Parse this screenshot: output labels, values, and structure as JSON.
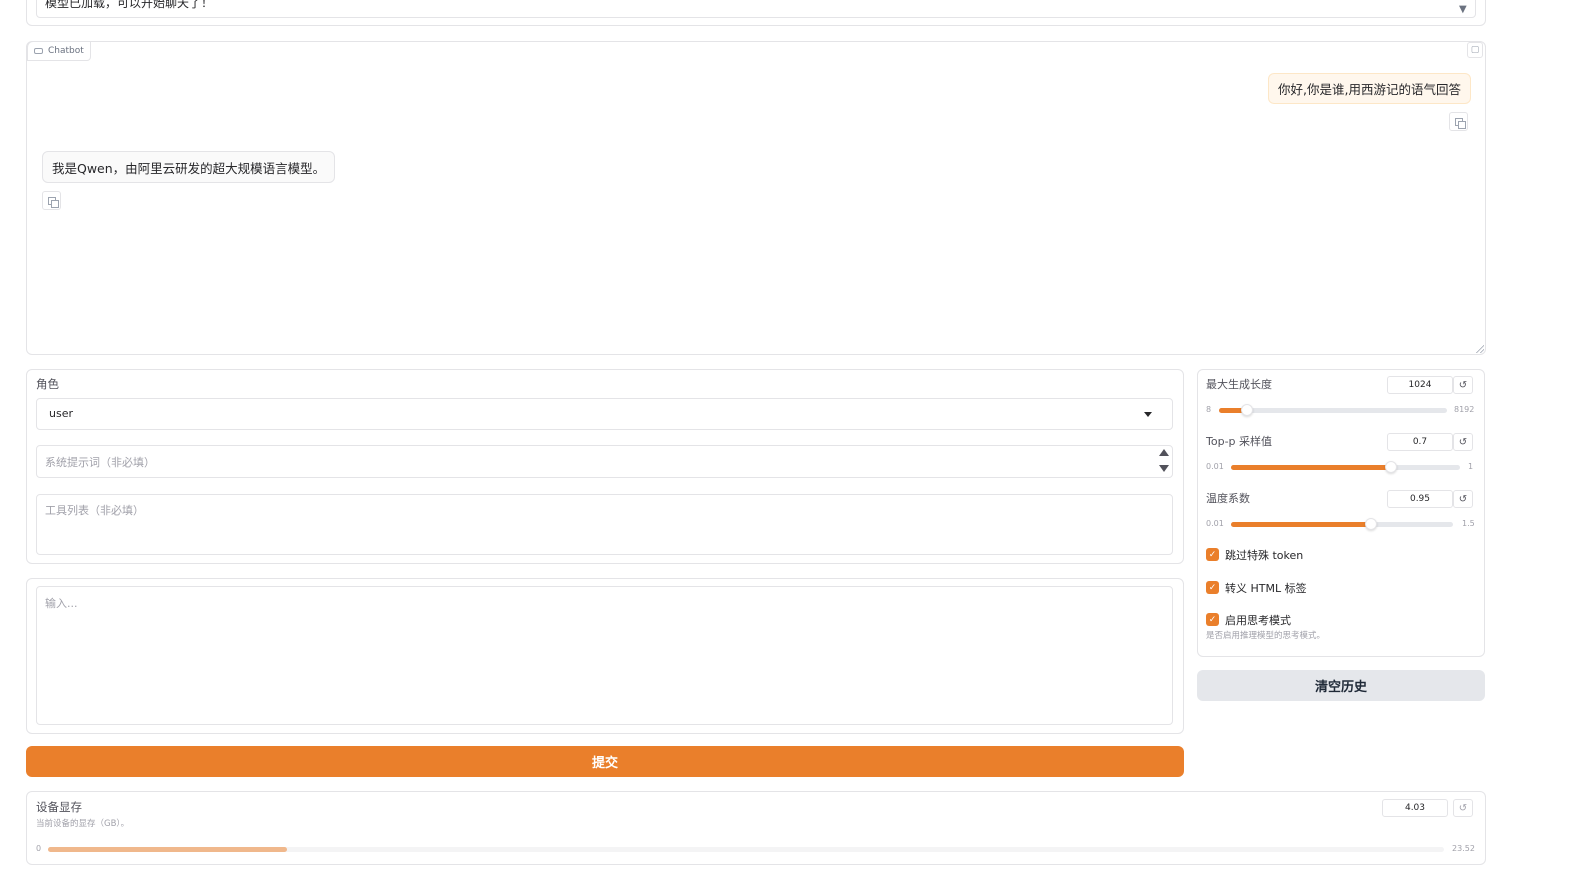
{
  "status": {
    "text": "模型已加载，可以开始聊天了！"
  },
  "chatbot": {
    "label": "Chatbot",
    "messages": [
      {
        "role": "user",
        "text": "你好,你是谁,用西游记的语气回答"
      },
      {
        "role": "assistant",
        "text": "我是Qwen，由阿里云研发的超大规模语言模型。"
      }
    ]
  },
  "settings": {
    "role_label": "角色",
    "role_value": "user",
    "system_prompt_placeholder": "系统提示词（非必填）",
    "tools_placeholder": "工具列表（非必填）"
  },
  "input": {
    "placeholder": "输入..."
  },
  "submit_label": "提交",
  "clear_label": "清空历史",
  "sliders": {
    "max_length": {
      "label": "最大生成长度",
      "value": "1024",
      "min": "8",
      "max": "8192",
      "fraction": 0.124
    },
    "top_p": {
      "label": "Top-p 采样值",
      "value": "0.7",
      "min": "0.01",
      "max": "1",
      "fraction": 0.697
    },
    "temperature": {
      "label": "温度系数",
      "value": "0.95",
      "min": "0.01",
      "max": "1.5",
      "fraction": 0.631
    }
  },
  "checkboxes": [
    {
      "label": "跳过特殊 token",
      "checked": true
    },
    {
      "label": "转义 HTML 标签",
      "checked": true
    },
    {
      "label": "启用思考模式",
      "checked": true,
      "info": "是否启用推理模型的思考模式。"
    }
  ],
  "memory": {
    "label": "设备显存",
    "info": "当前设备的显存（GB）。",
    "value": "4.03",
    "min": "0",
    "max": "23.52",
    "fraction": 0.171
  },
  "colors": {
    "accent": "#ea7f2b",
    "user_bubble": "#fff7ed"
  },
  "icons": {
    "reset": "↺",
    "trash": "🗑",
    "check": "✓"
  }
}
